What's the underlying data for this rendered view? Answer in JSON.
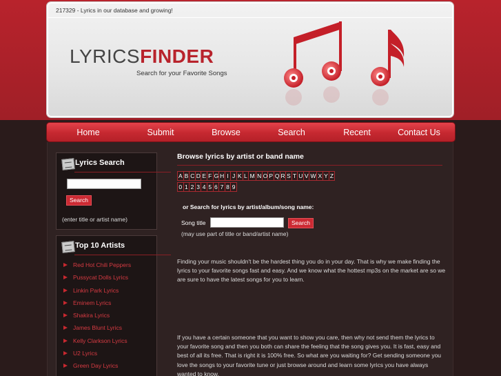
{
  "header": {
    "db_count": "217329 - Lyrics in our database and growing!",
    "logo_part1": "LYRICS",
    "logo_part2": "FINDER",
    "tagline": "Search for your Favorite Songs"
  },
  "nav": {
    "items": [
      "Home",
      "Submit",
      "Browse",
      "Search",
      "Recent",
      "Contact Us"
    ]
  },
  "sidebar": {
    "lyrics_search": {
      "title": "Lyrics Search",
      "search_button": "Search",
      "hint": "(enter title or artist name)"
    },
    "top_artists": {
      "title": "Top 10 Artists",
      "items": [
        "Red Hot Chili Peppers",
        "Pussycat Dolls Lyrics",
        "Linkin Park Lyrics",
        "Eminem Lyrics",
        "Shakira Lyrics",
        "James Blunt Lyrics",
        "Kelly Clarkson Lyrics",
        "U2 Lyrics",
        "Green Day Lyrics"
      ]
    }
  },
  "main": {
    "title": "Browse lyrics by artist or band name",
    "letters": [
      "A",
      "B",
      "C",
      "D",
      "E",
      "F",
      "G",
      "H",
      "I",
      "J",
      "K",
      "L",
      "M",
      "N",
      "O",
      "P",
      "Q",
      "R",
      "S",
      "T",
      "U",
      "V",
      "W",
      "X",
      "Y",
      "Z"
    ],
    "digits": [
      "0",
      "1",
      "2",
      "3",
      "4",
      "5",
      "6",
      "7",
      "8",
      "9"
    ],
    "or_search": "or Search for lyrics by artist/album/song name:",
    "song_title_label": "Song title",
    "search_button": "Search",
    "song_hint": "(may use part of title or band/artist name)",
    "paragraph1": "Finding your music shouldn't be the hardest thing you do in your day. That is why we make finding the lyrics to your favorite songs fast and easy. And we know what the hottest mp3s on the market are so we are sure to have the latest songs for you to learn.",
    "paragraph2": "If you have a certain someone that you want to show you care, then why not send them the lyrics to your favorite song and then you both can share the feeling that the song gives you. It is fast, easy and best of all its free. That is right it is 100% free. So what are you waiting for? Get sending someone you love the songs to your favorite tune or just browse around and learn some lyrics you have always wanted to know."
  },
  "colors": {
    "accent": "#cc2a33",
    "band": "#b8232c",
    "background": "#2a1b1b"
  }
}
